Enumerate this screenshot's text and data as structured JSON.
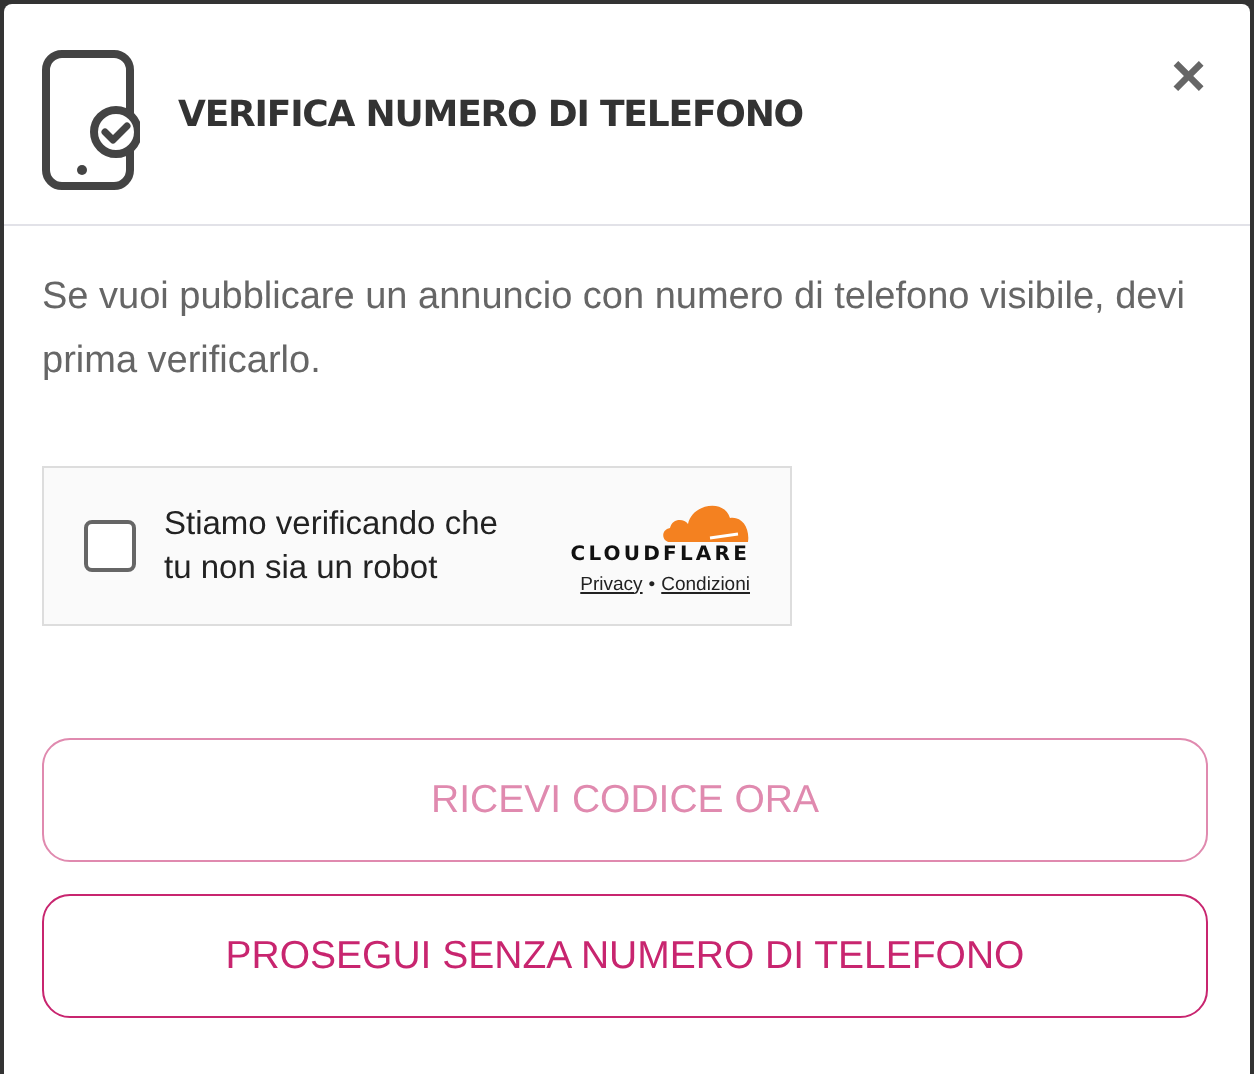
{
  "dialog": {
    "title": "VERIFICA NUMERO DI TELEFONO",
    "close": "×"
  },
  "message": "Se vuoi pubblicare un annuncio con numero di telefono visibile, devi prima verificarlo.",
  "captcha": {
    "checked": false,
    "label": "Stiamo verificando che tu non sia un robot",
    "brand": "CLOUDFLARE",
    "links": [
      "Privacy",
      "Condizioni"
    ],
    "separator": "•"
  },
  "buttons": [
    {
      "label": "RICEVI CODICE ORA",
      "disabled": true
    },
    {
      "label": "PROSEGUI SENZA NUMERO DI TELEFONO",
      "disabled": false
    }
  ]
}
